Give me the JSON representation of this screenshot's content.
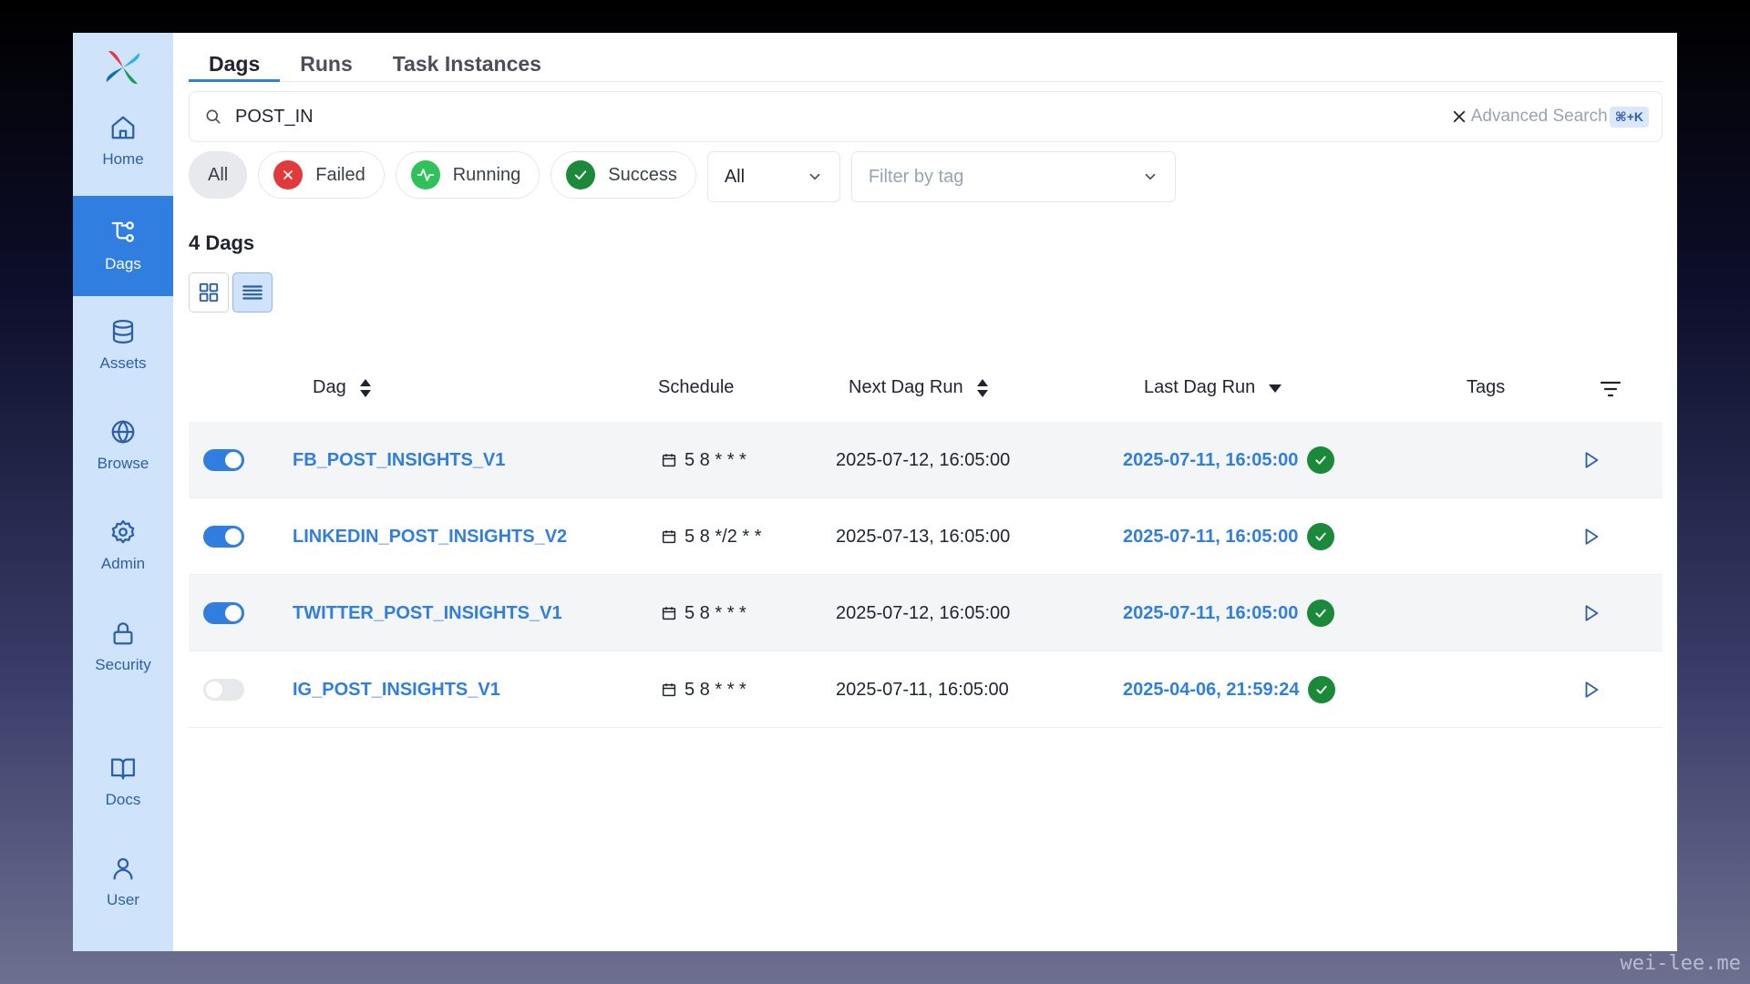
{
  "sidebar": {
    "items": [
      {
        "label": "Home",
        "icon": "home-icon"
      },
      {
        "label": "Dags",
        "icon": "dags-icon"
      },
      {
        "label": "Assets",
        "icon": "database-icon"
      },
      {
        "label": "Browse",
        "icon": "globe-icon"
      },
      {
        "label": "Admin",
        "icon": "gear-icon"
      },
      {
        "label": "Security",
        "icon": "lock-icon"
      },
      {
        "label": "Docs",
        "icon": "book-icon"
      },
      {
        "label": "User",
        "icon": "user-icon"
      }
    ],
    "active": "Dags"
  },
  "tabs": [
    "Dags",
    "Runs",
    "Task Instances"
  ],
  "search": {
    "value": "POST_IN",
    "advanced_label": "Advanced Search",
    "shortcut": "⌘+K"
  },
  "filters": {
    "all": "All",
    "failed": "Failed",
    "running": "Running",
    "success": "Success",
    "select_value": "All",
    "tag_placeholder": "Filter by tag"
  },
  "count_label": "4 Dags",
  "table": {
    "headers": {
      "dag": "Dag",
      "schedule": "Schedule",
      "next_run": "Next Dag Run",
      "last_run": "Last Dag Run",
      "tags": "Tags"
    },
    "rows": [
      {
        "enabled": true,
        "name": "FB_POST_INSIGHTS_V1",
        "schedule": "5 8 * * *",
        "next_run": "2025-07-12, 16:05:00",
        "last_run": "2025-07-11, 16:05:00"
      },
      {
        "enabled": true,
        "name": "LINKEDIN_POST_INSIGHTS_V2",
        "schedule": "5 8 */2 * *",
        "next_run": "2025-07-13, 16:05:00",
        "last_run": "2025-07-11, 16:05:00"
      },
      {
        "enabled": true,
        "name": "TWITTER_POST_INSIGHTS_V1",
        "schedule": "5 8 * * *",
        "next_run": "2025-07-12, 16:05:00",
        "last_run": "2025-07-11, 16:05:00"
      },
      {
        "enabled": false,
        "name": "IG_POST_INSIGHTS_V1",
        "schedule": "5 8 * * *",
        "next_run": "2025-07-11, 16:05:00",
        "last_run": "2025-04-06, 21:59:24"
      }
    ]
  },
  "watermark": "wei-lee.me",
  "colors": {
    "accent": "#2f7ee0",
    "sidebar": "#cfe3fb",
    "failed": "#e03a3a",
    "running": "#2fc25b",
    "success": "#1a8a3a"
  }
}
